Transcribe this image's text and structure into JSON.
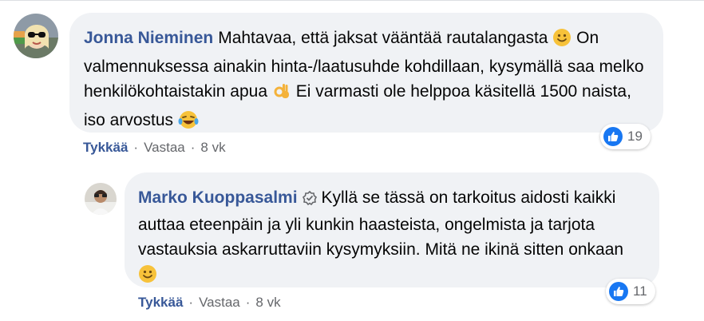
{
  "comments": [
    {
      "author": "Jonna Nieminen",
      "text_1": "Mahtavaa, että jaksat vääntää rautalangasta",
      "text_2": "On valmennuksessa ainakin hinta-/laatusuhde kohdillaan, kysymällä saa melko henkilökohtaistakin apua",
      "text_3": "Ei varmasti ole helppoa käsitellä 1500 naista, iso arvostus",
      "emoji_1": "slightly-smiling-face",
      "emoji_2": "ok-hand",
      "emoji_3": "tears-of-joy",
      "like_label": "Tykkää",
      "reply_label": "Vastaa",
      "time": "8 vk",
      "reaction_count": "19"
    },
    {
      "author": "Marko Kuoppasalmi",
      "text_1": "Kyllä se tässä on tarkoitus aidosti kaikki auttaa eteenpäin ja yli kunkin haasteista, ongelmista ja tarjota vastauksia askarruttaviin kysymyksiin. Mitä ne ikinä sitten onkaan",
      "emoji_1": "slightly-smiling-face",
      "like_label": "Tykkää",
      "reply_label": "Vastaa",
      "time": "8 vk",
      "reaction_count": "11"
    }
  ],
  "separator": "·",
  "colors": {
    "author": "#385898",
    "bubble": "#f0f2f5",
    "like": "#1877f2",
    "meta": "#65676b"
  }
}
